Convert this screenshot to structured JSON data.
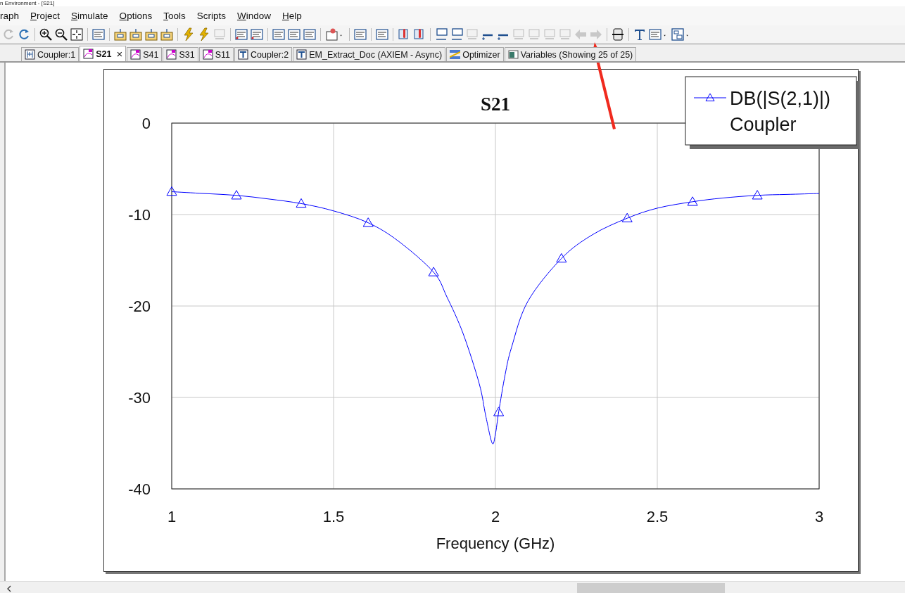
{
  "window": {
    "title": "n Environment - [S21]"
  },
  "menu": [
    {
      "label": "raph",
      "underline_first": false
    },
    {
      "label": "Project",
      "underline_first": true
    },
    {
      "label": "Simulate",
      "underline_first": true
    },
    {
      "label": "Options",
      "underline_first": true
    },
    {
      "label": "Tools",
      "underline_first": true
    },
    {
      "label": "Scripts",
      "underline_first": false
    },
    {
      "label": "Window",
      "underline_first": true
    },
    {
      "label": "Help",
      "underline_first": true
    }
  ],
  "tabs": [
    {
      "label": "Coupler:1",
      "kind": "schematic-alt",
      "selected": false
    },
    {
      "label": "S21",
      "kind": "graph",
      "selected": true,
      "close": "×"
    },
    {
      "label": "S41",
      "kind": "graph",
      "selected": false
    },
    {
      "label": "S31",
      "kind": "graph",
      "selected": false
    },
    {
      "label": "S11",
      "kind": "graph",
      "selected": false
    },
    {
      "label": "Coupler:2",
      "kind": "schematic",
      "selected": false
    },
    {
      "label": "EM_Extract_Doc (AXIEM - Async)",
      "kind": "schematic",
      "selected": false
    },
    {
      "label": "Optimizer",
      "kind": "optimizer",
      "selected": false
    },
    {
      "label": "Variables (Showing 25 of 25)",
      "kind": "variables",
      "selected": false
    }
  ],
  "graph": {
    "legend_source": "Coupler",
    "chart_data": {
      "type": "line",
      "grid": true,
      "title": "S21",
      "xlabel": "Frequency (GHz)",
      "xlim": [
        1,
        3
      ],
      "ylim": [
        -40,
        0
      ],
      "xticks": [
        1,
        {
          "value": 1.5,
          "label": "1.5"
        },
        2,
        {
          "value": 2.5,
          "label": "2.5"
        },
        3
      ],
      "yticks": [
        0,
        -10,
        -20,
        -30,
        -40
      ],
      "x": [
        1,
        1.1,
        1.2,
        1.3,
        1.4,
        1.5,
        1.607,
        1.7,
        1.809,
        1.85,
        1.9,
        1.95,
        1.97,
        1.99,
        2.0,
        2.01,
        2.03,
        2.05,
        2.1,
        2.204,
        2.3,
        2.407,
        2.5,
        2.609,
        2.7,
        2.809,
        2.9,
        3
      ],
      "series": [
        {
          "name": "DB(|S(2,1)|)",
          "color": "#0000ff",
          "values": [
            -7.5,
            -7.7,
            -7.9,
            -8.3,
            -8.8,
            -9.6,
            -10.9,
            -12.9,
            -16.3,
            -19,
            -23,
            -28.5,
            -32,
            -35,
            -34,
            -31.6,
            -27.5,
            -24.5,
            -19.5,
            -14.8,
            -12.2,
            -10.4,
            -9.3,
            -8.6,
            -8.2,
            -7.9,
            -7.8,
            -7.7
          ]
        }
      ]
    }
  }
}
